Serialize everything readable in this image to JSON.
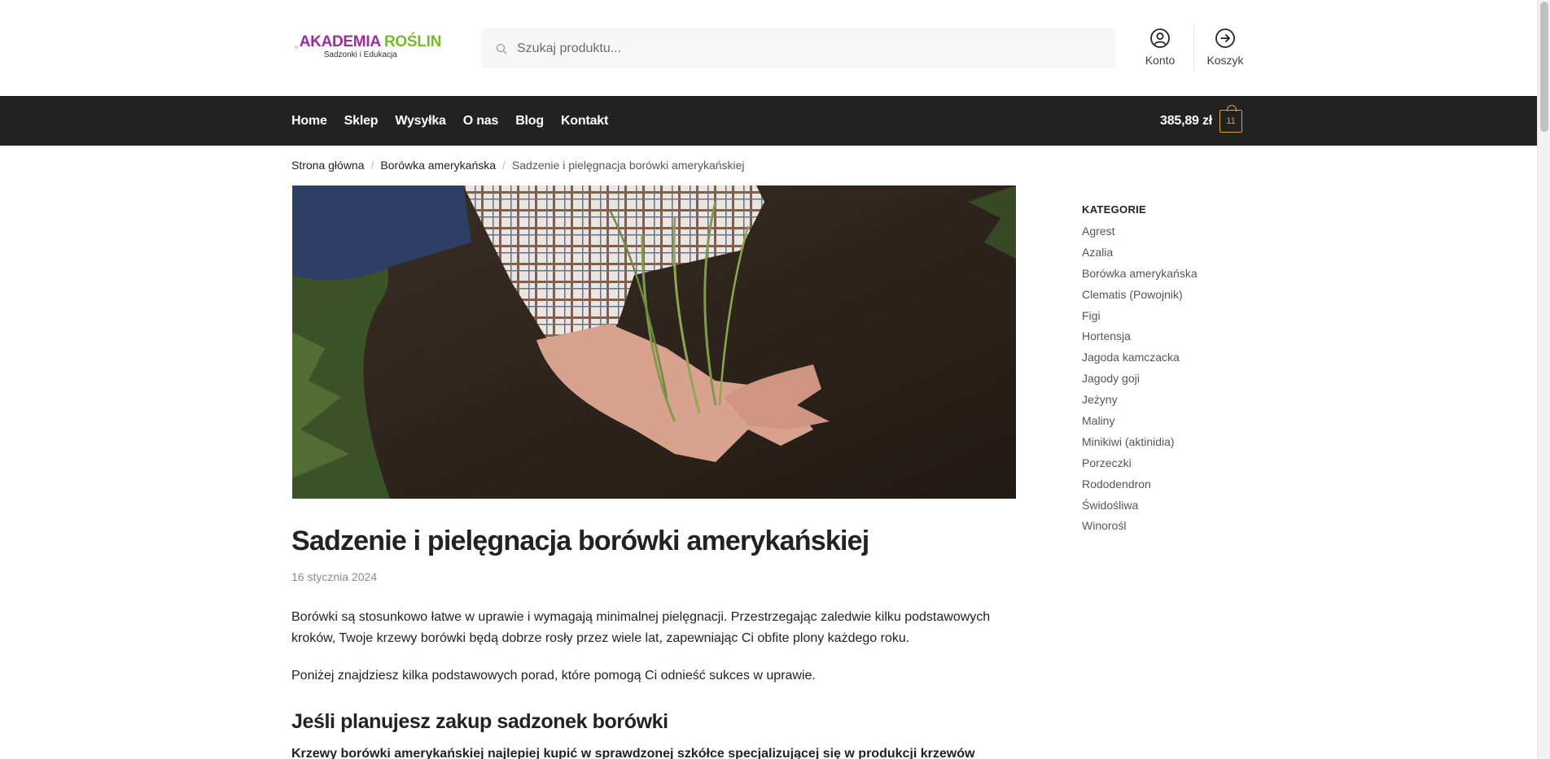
{
  "brand": {
    "name_part1": "AKADEMIA ",
    "name_part2": "ROŚLIN",
    "tagline": "Sadzonki i Edukacja"
  },
  "search": {
    "placeholder": "Szukaj produktu..."
  },
  "header_links": {
    "account": "Konto",
    "cart": "Koszyk"
  },
  "nav": {
    "items": [
      "Home",
      "Sklep",
      "Wysyłka",
      "O nas",
      "Blog",
      "Kontakt"
    ],
    "cart_total": "385,89 zł",
    "cart_count": "11"
  },
  "breadcrumb": {
    "home": "Strona główna",
    "category": "Borówka amerykańska",
    "current": "Sadzenie i pielęgnacja borówki amerykańskiej"
  },
  "post": {
    "title": "Sadzenie i pielęgnacja borówki amerykańskiej",
    "date": "16 stycznia 2024",
    "paragraph1": "Borówki są stosunkowo łatwe w uprawie i wymagają minimalnej pielęgnacji. Przestrzegając zaledwie kilku podstawowych kroków, Twoje krzewy borówki będą dobrze rosły przez wiele lat, zapewniając Ci obfite plony każdego roku.",
    "paragraph2": "Poniżej znajdziesz kilka podstawowych porad, które pomogą Ci odnieść sukces w uprawie.",
    "heading2": "Jeśli planujesz zakup sadzonek borówki",
    "paragraph3": "Krzewy borówki amerykańskiej najlepiej kupić w sprawdzonej szkółce specjalizującej się w produkcji krzewów"
  },
  "sidebar": {
    "title": "KATEGORIE",
    "items": [
      "Agrest",
      "Azalia",
      "Borówka amerykańska",
      "Clematis (Powojnik)",
      "Figi",
      "Hortensja",
      "Jagoda kamczacka",
      "Jagody goji",
      "Jeżyny",
      "Maliny",
      "Minikiwi (aktinidia)",
      "Porzeczki",
      "Rododendron",
      "Świdośliwa",
      "Winorośl"
    ]
  },
  "colors": {
    "nav_bg": "#222222",
    "cart_accent": "#e2a12b",
    "brand_purple": "#9c2c9a",
    "brand_green": "#7ab929"
  }
}
